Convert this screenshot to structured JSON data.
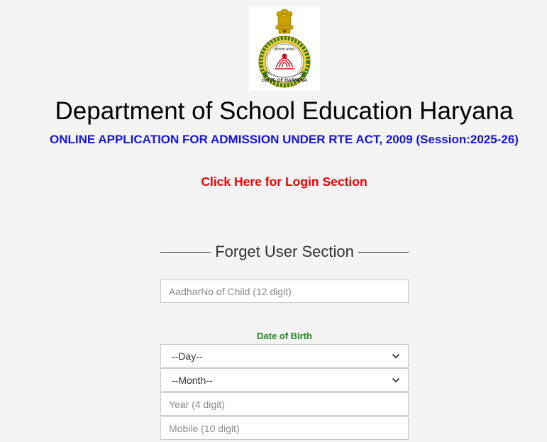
{
  "header": {
    "logo_text_top": "हरियाणा सरकार",
    "logo_text_bottom": "GOVT. OF HARYANA",
    "title": "Department of School Education Haryana",
    "subtitle": "ONLINE APPLICATION FOR ADMISSION UNDER RTE ACT, 2009 (Session:2025-26)",
    "login_link": "Click Here for Login Section"
  },
  "form": {
    "section_title": "Forget User Section",
    "aadhar_placeholder": "AadharNo of Child (12 digit)",
    "dob_label": "Date of Birth",
    "day_selected": "--Day--",
    "month_selected": "--Month--",
    "year_placeholder": "Year (4 digit)",
    "mobile_placeholder": "Mobile (10 digit)"
  },
  "colors": {
    "subtitle": "#1515d6",
    "login_link": "#ee0000",
    "dob_label": "#228b22"
  }
}
